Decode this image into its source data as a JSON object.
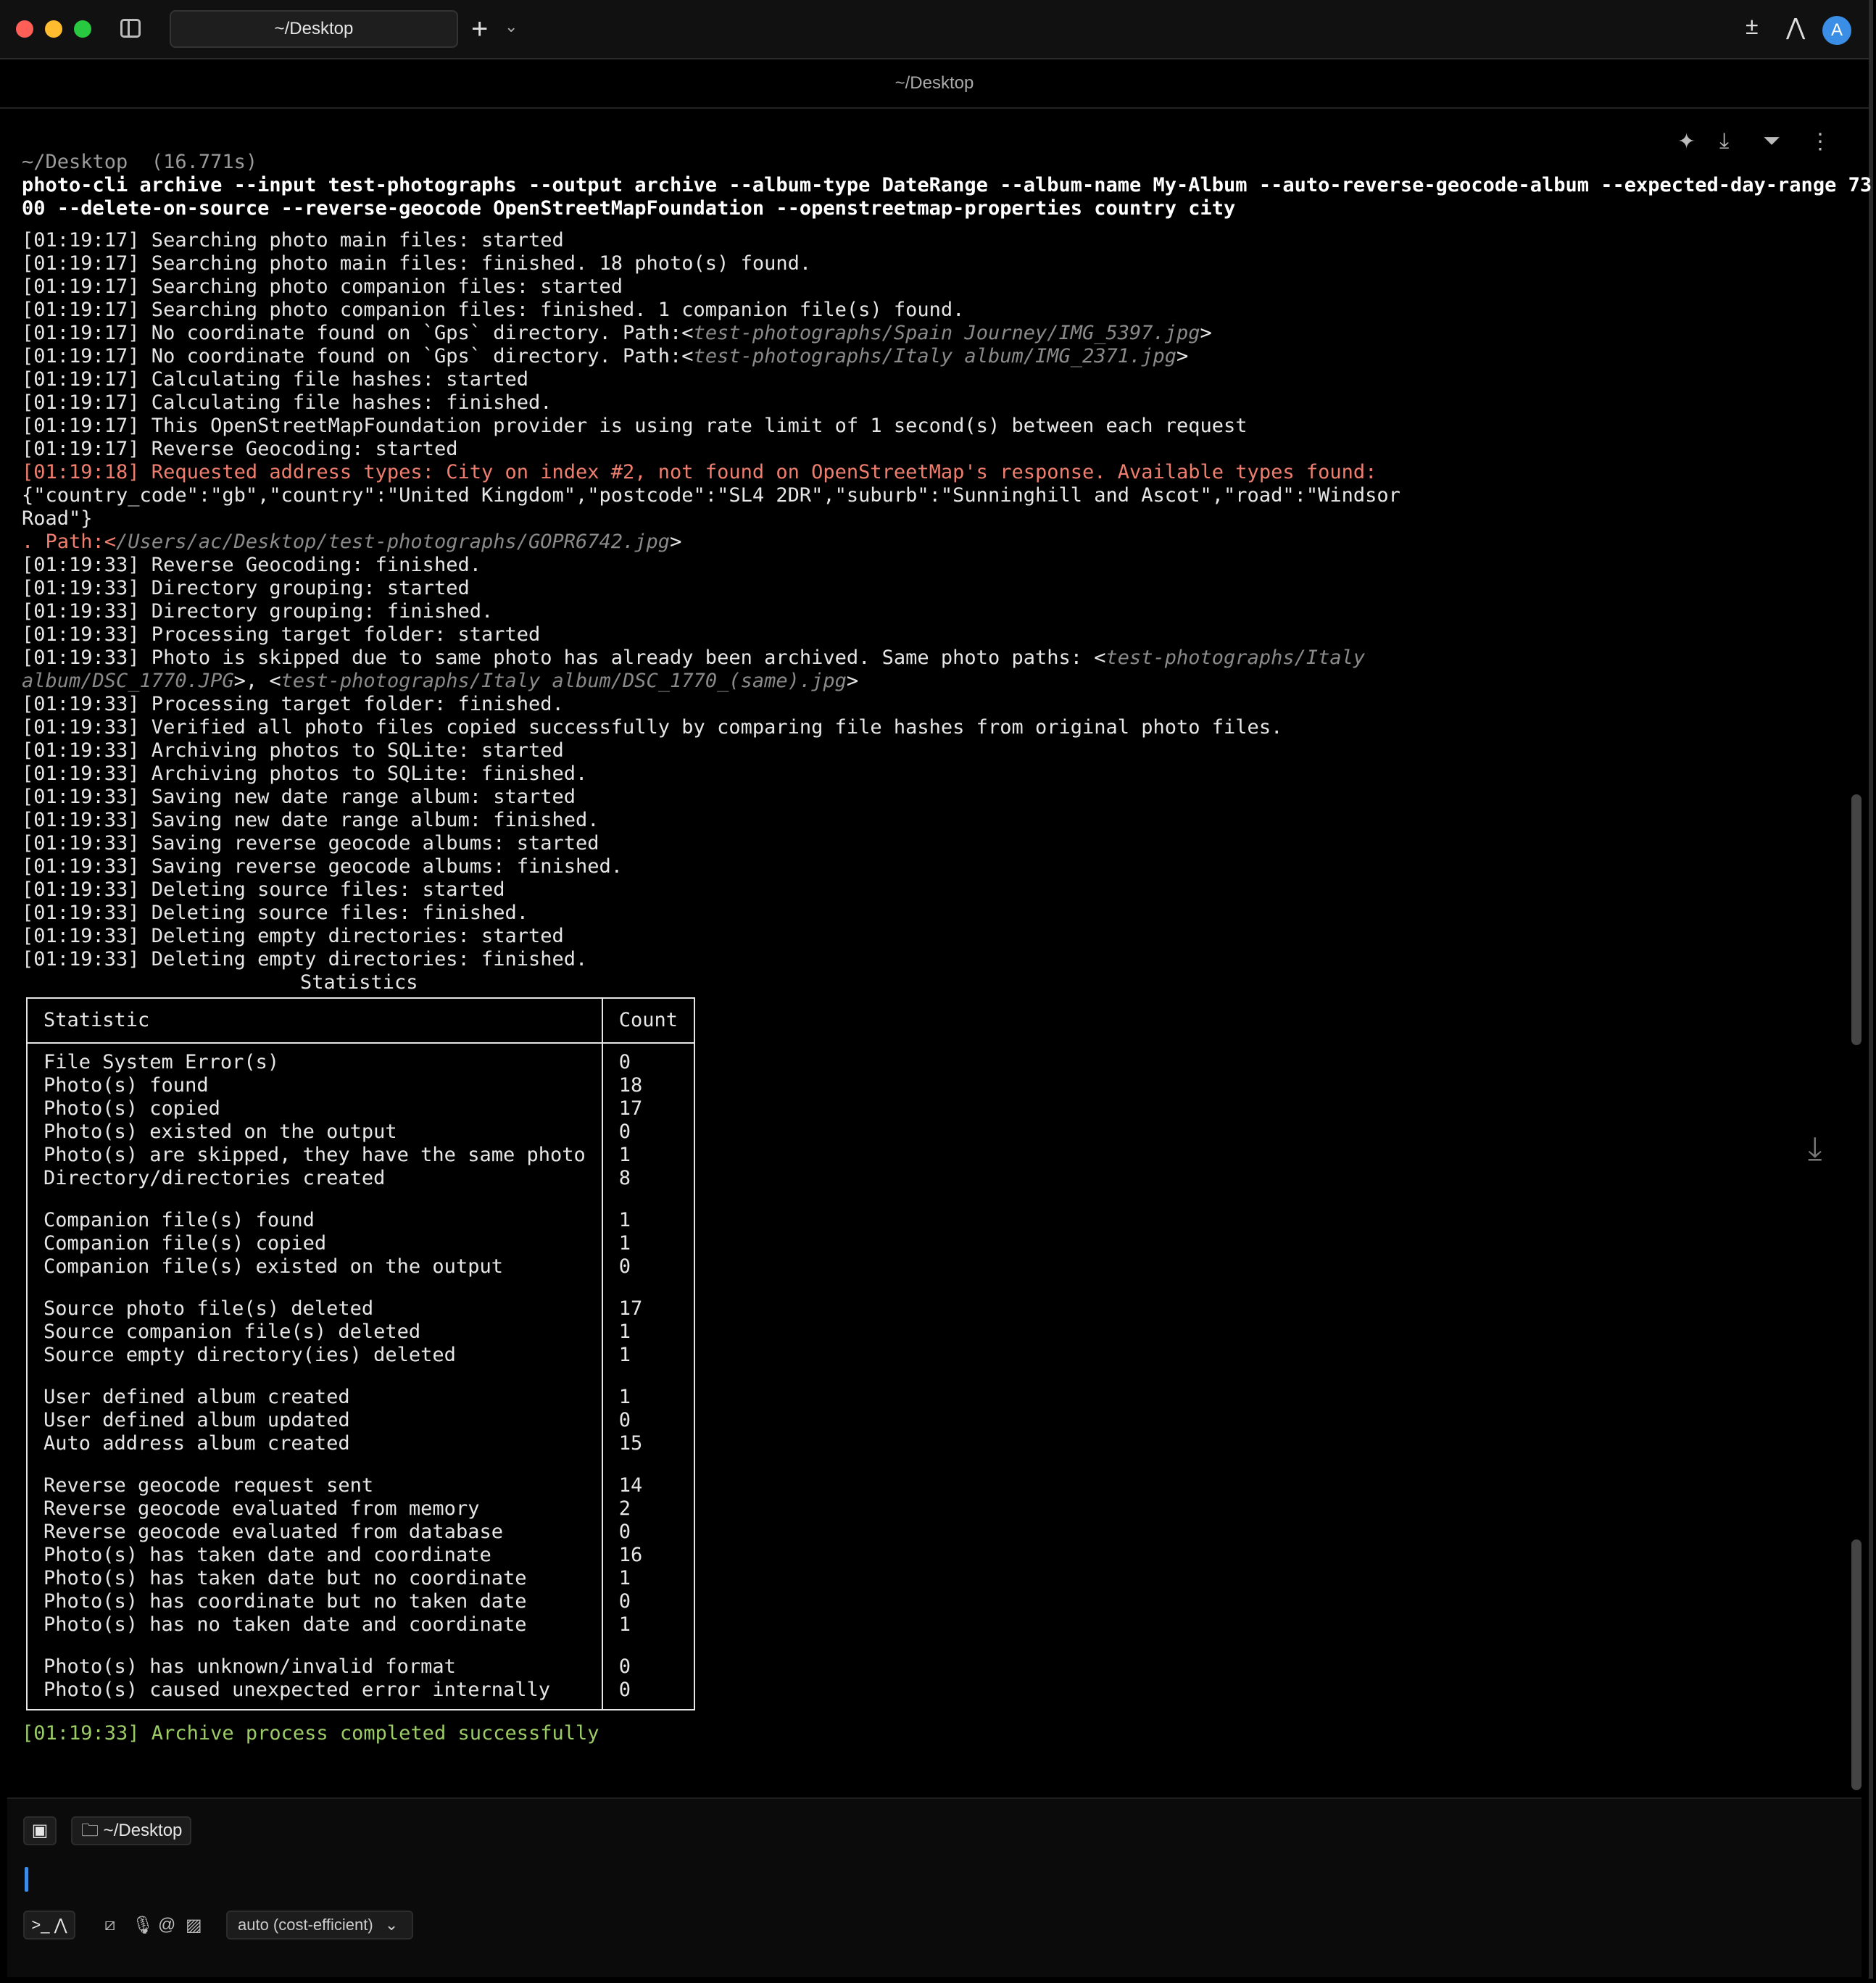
{
  "window": {
    "tab_title": "~/Desktop",
    "path_header": "~/Desktop",
    "avatar_letter": "A"
  },
  "block": {
    "header": "~/Desktop  (16.771s)",
    "command_1": "photo-cli archive --input test-photographs --output archive --album-type DateRange --album-name My-Album --auto-reverse-geocode-album --expected-day-range 73",
    "command_2": "00 --delete-on-source --reverse-geocode OpenStreetMapFoundation --openstreetmap-properties country city"
  },
  "log": {
    "l1": "[01:19:17] Searching photo main files: started",
    "l2": "[01:19:17] Searching photo main files: finished. 18 photo(s) found.",
    "l3": "[01:19:17] Searching photo companion files: started",
    "l4": "[01:19:17] Searching photo companion files: finished. 1 companion file(s) found.",
    "l5a": "[01:19:17] No coordinate found on `Gps` directory. Path:<",
    "l5b": "test-photographs/Spain Journey/IMG_5397.jpg",
    "l5c": ">",
    "l6a": "[01:19:17] No coordinate found on `Gps` directory. Path:<",
    "l6b": "test-photographs/Italy album/IMG_2371.jpg",
    "l6c": ">",
    "l7": "[01:19:17] Calculating file hashes: started",
    "l8": "[01:19:17] Calculating file hashes: finished.",
    "l9": "[01:19:17] This OpenStreetMapFoundation provider is using rate limit of 1 second(s) between each request",
    "l10": "[01:19:17] Reverse Geocoding: started",
    "l11": "[01:19:18] Requested address types: City on index #2, not found on OpenStreetMap's response. Available types found:",
    "l12": "{\"country_code\":\"gb\",\"country\":\"United Kingdom\",\"postcode\":\"SL4 2DR\",\"suburb\":\"Sunninghill and Ascot\",\"road\":\"Windsor",
    "l13": "Road\"}",
    "l14a": ". Path:<",
    "l14b": "/Users/ac/Desktop/test-photographs/GOPR6742.jpg",
    "l14c": ">",
    "l15": "[01:19:33] Reverse Geocoding: finished.",
    "l16": "[01:19:33] Directory grouping: started",
    "l17": "[01:19:33] Directory grouping: finished.",
    "l18": "[01:19:33] Processing target folder: started",
    "l19a": "[01:19:33] Photo is skipped due to same photo has already been archived. Same photo paths: <",
    "l19b": "test-photographs/Italy",
    "l20a": "album/DSC_1770.JPG",
    "l20b": ">, <",
    "l20c": "test-photographs/Italy album/DSC_1770_(same).jpg",
    "l20d": ">",
    "l21": "[01:19:33] Processing target folder: finished.",
    "l22": "[01:19:33] Verified all photo files copied successfully by comparing file hashes from original photo files.",
    "l23": "[01:19:33] Archiving photos to SQLite: started",
    "l24": "[01:19:33] Archiving photos to SQLite: finished.",
    "l25": "[01:19:33] Saving new date range album: started",
    "l26": "[01:19:33] Saving new date range album: finished.",
    "l27": "[01:19:33] Saving reverse geocode albums: started",
    "l28": "[01:19:33] Saving reverse geocode albums: finished.",
    "l29": "[01:19:33] Deleting source files: started",
    "l30": "[01:19:33] Deleting source files: finished.",
    "l31": "[01:19:33] Deleting empty directories: started",
    "l32": "[01:19:33] Deleting empty directories: finished.",
    "done": "[01:19:33] Archive process completed successfully"
  },
  "stats": {
    "title": "Statistics",
    "col_statistic": "Statistic",
    "col_count": "Count",
    "rows": [
      {
        "name": "File System Error(s)",
        "count": "0"
      },
      {
        "name": "Photo(s) found",
        "count": "18"
      },
      {
        "name": "Photo(s) copied",
        "count": "17"
      },
      {
        "name": "Photo(s) existed on the output",
        "count": "0"
      },
      {
        "name": "Photo(s) are skipped, they have the same photo",
        "count": "1"
      },
      {
        "name": "Directory/directories created",
        "count": "8"
      },
      {
        "name": "Companion file(s) found",
        "count": "1"
      },
      {
        "name": "Companion file(s) copied",
        "count": "1"
      },
      {
        "name": "Companion file(s) existed on the output",
        "count": "0"
      },
      {
        "name": "Source photo file(s) deleted",
        "count": "17"
      },
      {
        "name": "Source companion file(s) deleted",
        "count": "1"
      },
      {
        "name": "Source empty directory(ies) deleted",
        "count": "1"
      },
      {
        "name": "User defined album created",
        "count": "1"
      },
      {
        "name": "User defined album updated",
        "count": "0"
      },
      {
        "name": "Auto address album created",
        "count": "15"
      },
      {
        "name": "Reverse geocode request sent",
        "count": "14"
      },
      {
        "name": "Reverse geocode evaluated from memory",
        "count": "2"
      },
      {
        "name": "Reverse geocode evaluated from database",
        "count": "0"
      },
      {
        "name": "Photo(s) has taken date and coordinate",
        "count": "16"
      },
      {
        "name": "Photo(s) has taken date but no coordinate",
        "count": "1"
      },
      {
        "name": "Photo(s) has coordinate but no taken date",
        "count": "0"
      },
      {
        "name": "Photo(s) has no taken date and coordinate",
        "count": "1"
      },
      {
        "name": "Photo(s) has unknown/invalid format",
        "count": "0"
      },
      {
        "name": "Photo(s) caused unexpected error internally",
        "count": "0"
      }
    ]
  },
  "input": {
    "context_chip": "~/Desktop",
    "model": "auto (cost-efficient)"
  },
  "icons": {
    "sidebar": "sidebar-toggle-icon",
    "new_tab": "plus-icon",
    "dropdown": "chevron-down-icon"
  }
}
